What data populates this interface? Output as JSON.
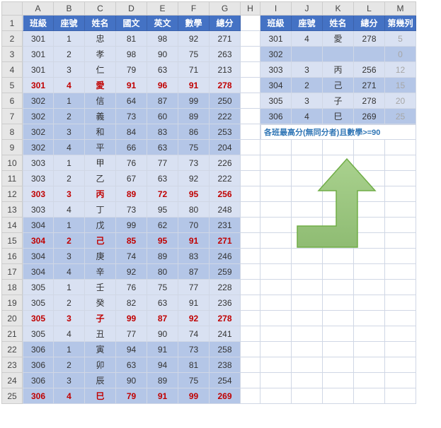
{
  "columns": [
    "A",
    "B",
    "C",
    "D",
    "E",
    "F",
    "G",
    "H",
    "I",
    "J",
    "K",
    "L",
    "M"
  ],
  "rowNumbers": [
    1,
    2,
    3,
    4,
    5,
    6,
    7,
    8,
    9,
    10,
    11,
    12,
    13,
    14,
    15,
    16,
    17,
    18,
    19,
    20,
    21,
    22,
    23,
    24,
    25
  ],
  "leftHeader": {
    "class": "班級",
    "seat": "座號",
    "name": "姓名",
    "chinese": "國文",
    "english": "英文",
    "math": "數學",
    "total": "總分"
  },
  "rightHeader": {
    "class": "班級",
    "seat": "座號",
    "name": "姓名",
    "total": "總分",
    "rownum": "第幾列"
  },
  "leftData": [
    {
      "class": "301",
      "seat": "1",
      "name": "忠",
      "c": "81",
      "e": "98",
      "m": "92",
      "t": "271",
      "band": 1,
      "hl": false
    },
    {
      "class": "301",
      "seat": "2",
      "name": "孝",
      "c": "98",
      "e": "90",
      "m": "75",
      "t": "263",
      "band": 1,
      "hl": false
    },
    {
      "class": "301",
      "seat": "3",
      "name": "仁",
      "c": "79",
      "e": "63",
      "m": "71",
      "t": "213",
      "band": 1,
      "hl": false
    },
    {
      "class": "301",
      "seat": "4",
      "name": "愛",
      "c": "91",
      "e": "96",
      "m": "91",
      "t": "278",
      "band": 1,
      "hl": true
    },
    {
      "class": "302",
      "seat": "1",
      "name": "信",
      "c": "64",
      "e": "87",
      "m": "99",
      "t": "250",
      "band": 2,
      "hl": false
    },
    {
      "class": "302",
      "seat": "2",
      "name": "義",
      "c": "73",
      "e": "60",
      "m": "89",
      "t": "222",
      "band": 2,
      "hl": false
    },
    {
      "class": "302",
      "seat": "3",
      "name": "和",
      "c": "84",
      "e": "83",
      "m": "86",
      "t": "253",
      "band": 2,
      "hl": false
    },
    {
      "class": "302",
      "seat": "4",
      "name": "平",
      "c": "66",
      "e": "63",
      "m": "75",
      "t": "204",
      "band": 2,
      "hl": false
    },
    {
      "class": "303",
      "seat": "1",
      "name": "甲",
      "c": "76",
      "e": "77",
      "m": "73",
      "t": "226",
      "band": 1,
      "hl": false
    },
    {
      "class": "303",
      "seat": "2",
      "name": "乙",
      "c": "67",
      "e": "63",
      "m": "92",
      "t": "222",
      "band": 1,
      "hl": false
    },
    {
      "class": "303",
      "seat": "3",
      "name": "丙",
      "c": "89",
      "e": "72",
      "m": "95",
      "t": "256",
      "band": 1,
      "hl": true
    },
    {
      "class": "303",
      "seat": "4",
      "name": "丁",
      "c": "73",
      "e": "95",
      "m": "80",
      "t": "248",
      "band": 1,
      "hl": false
    },
    {
      "class": "304",
      "seat": "1",
      "name": "戊",
      "c": "99",
      "e": "62",
      "m": "70",
      "t": "231",
      "band": 2,
      "hl": false
    },
    {
      "class": "304",
      "seat": "2",
      "name": "己",
      "c": "85",
      "e": "95",
      "m": "91",
      "t": "271",
      "band": 2,
      "hl": true
    },
    {
      "class": "304",
      "seat": "3",
      "name": "庚",
      "c": "74",
      "e": "89",
      "m": "83",
      "t": "246",
      "band": 2,
      "hl": false
    },
    {
      "class": "304",
      "seat": "4",
      "name": "辛",
      "c": "92",
      "e": "80",
      "m": "87",
      "t": "259",
      "band": 2,
      "hl": false
    },
    {
      "class": "305",
      "seat": "1",
      "name": "壬",
      "c": "76",
      "e": "75",
      "m": "77",
      "t": "228",
      "band": 1,
      "hl": false
    },
    {
      "class": "305",
      "seat": "2",
      "name": "癸",
      "c": "82",
      "e": "63",
      "m": "91",
      "t": "236",
      "band": 1,
      "hl": false
    },
    {
      "class": "305",
      "seat": "3",
      "name": "子",
      "c": "99",
      "e": "87",
      "m": "92",
      "t": "278",
      "band": 1,
      "hl": true
    },
    {
      "class": "305",
      "seat": "4",
      "name": "丑",
      "c": "77",
      "e": "90",
      "m": "74",
      "t": "241",
      "band": 1,
      "hl": false
    },
    {
      "class": "306",
      "seat": "1",
      "name": "寅",
      "c": "94",
      "e": "91",
      "m": "73",
      "t": "258",
      "band": 2,
      "hl": false
    },
    {
      "class": "306",
      "seat": "2",
      "name": "卯",
      "c": "63",
      "e": "94",
      "m": "81",
      "t": "238",
      "band": 2,
      "hl": false
    },
    {
      "class": "306",
      "seat": "3",
      "name": "辰",
      "c": "90",
      "e": "89",
      "m": "75",
      "t": "254",
      "band": 2,
      "hl": false
    },
    {
      "class": "306",
      "seat": "4",
      "name": "巳",
      "c": "79",
      "e": "91",
      "m": "99",
      "t": "269",
      "band": 2,
      "hl": true
    }
  ],
  "rightData": [
    {
      "class": "301",
      "seat": "4",
      "name": "愛",
      "t": "278",
      "rn": "5",
      "band": 1
    },
    {
      "class": "302",
      "seat": "",
      "name": "",
      "t": "",
      "rn": "0",
      "band": 2
    },
    {
      "class": "303",
      "seat": "3",
      "name": "丙",
      "t": "256",
      "rn": "12",
      "band": 1
    },
    {
      "class": "304",
      "seat": "2",
      "name": "己",
      "t": "271",
      "rn": "15",
      "band": 2
    },
    {
      "class": "305",
      "seat": "3",
      "name": "子",
      "t": "278",
      "rn": "20",
      "band": 1
    },
    {
      "class": "306",
      "seat": "4",
      "name": "巳",
      "t": "269",
      "rn": "25",
      "band": 2
    }
  ],
  "note": "各班最高分(無同分者)且數學>=90",
  "chart_data": {
    "type": "table",
    "title": "Excel score data with per-class max filter",
    "left_table": {
      "columns": [
        "班級",
        "座號",
        "姓名",
        "國文",
        "英文",
        "數學",
        "總分"
      ],
      "rows": [
        [
          "301",
          1,
          "忠",
          81,
          98,
          92,
          271
        ],
        [
          "301",
          2,
          "孝",
          98,
          90,
          75,
          263
        ],
        [
          "301",
          3,
          "仁",
          79,
          63,
          71,
          213
        ],
        [
          "301",
          4,
          "愛",
          91,
          96,
          91,
          278
        ],
        [
          "302",
          1,
          "信",
          64,
          87,
          99,
          250
        ],
        [
          "302",
          2,
          "義",
          73,
          60,
          89,
          222
        ],
        [
          "302",
          3,
          "和",
          84,
          83,
          86,
          253
        ],
        [
          "302",
          4,
          "平",
          66,
          63,
          75,
          204
        ],
        [
          "303",
          1,
          "甲",
          76,
          77,
          73,
          226
        ],
        [
          "303",
          2,
          "乙",
          67,
          63,
          92,
          222
        ],
        [
          "303",
          3,
          "丙",
          89,
          72,
          95,
          256
        ],
        [
          "303",
          4,
          "丁",
          73,
          95,
          80,
          248
        ],
        [
          "304",
          1,
          "戊",
          99,
          62,
          70,
          231
        ],
        [
          "304",
          2,
          "己",
          85,
          95,
          91,
          271
        ],
        [
          "304",
          3,
          "庚",
          74,
          89,
          83,
          246
        ],
        [
          "304",
          4,
          "辛",
          92,
          80,
          87,
          259
        ],
        [
          "305",
          1,
          "壬",
          76,
          75,
          77,
          228
        ],
        [
          "305",
          2,
          "癸",
          82,
          63,
          91,
          236
        ],
        [
          "305",
          3,
          "子",
          99,
          87,
          92,
          278
        ],
        [
          "305",
          4,
          "丑",
          77,
          90,
          74,
          241
        ],
        [
          "306",
          1,
          "寅",
          94,
          91,
          73,
          258
        ],
        [
          "306",
          2,
          "卯",
          63,
          94,
          81,
          238
        ],
        [
          "306",
          3,
          "辰",
          90,
          89,
          75,
          254
        ],
        [
          "306",
          4,
          "巳",
          79,
          91,
          99,
          269
        ]
      ]
    },
    "right_table": {
      "columns": [
        "班級",
        "座號",
        "姓名",
        "總分",
        "第幾列"
      ],
      "rows": [
        [
          "301",
          4,
          "愛",
          278,
          5
        ],
        [
          "302",
          null,
          null,
          null,
          0
        ],
        [
          "303",
          3,
          "丙",
          256,
          12
        ],
        [
          "304",
          2,
          "己",
          271,
          15
        ],
        [
          "305",
          3,
          "子",
          278,
          20
        ],
        [
          "306",
          4,
          "巳",
          269,
          25
        ]
      ],
      "criterion": "各班最高分(無同分者)且數學>=90"
    }
  }
}
